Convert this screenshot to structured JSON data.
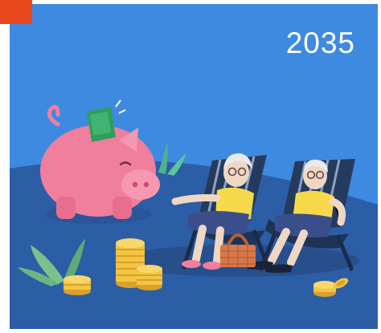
{
  "year_label": "2035",
  "icons": [
    "piggy-bank-icon",
    "banknote-icon",
    "coin-stack-icon",
    "deck-chair-icon",
    "picnic-basket-icon",
    "plant-icon"
  ],
  "colors": {
    "background": "#3f8ae1",
    "hill": "#2c5ea6",
    "accent_tag": "#e8461c",
    "piggy": "#f07f9d",
    "coin": "#f4c543",
    "shirt": "#f6d94a"
  }
}
